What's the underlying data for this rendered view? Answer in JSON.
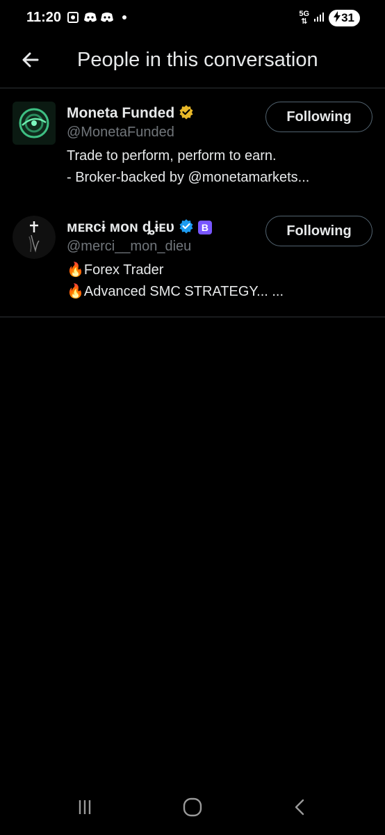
{
  "status_bar": {
    "time": "11:20",
    "network": "5G",
    "battery": "31"
  },
  "header": {
    "title": "People in this conversation"
  },
  "people": [
    {
      "name": "Moneta Funded",
      "handle": "@MonetaFunded",
      "bio_line1": "Trade to perform, perform to earn.",
      "bio_line2": "- Broker-backed by @monetamarkets...",
      "follow_label": "Following",
      "verified_color": "#e8b829"
    },
    {
      "name": "ᴍᴇʀᴄɨ ᴍᴏɴ ȡɨᴇᴜ",
      "handle": "@merci__mon_dieu",
      "bio_line1": "🔥Forex Trader",
      "bio_line2": "🔥Advanced SMC STRATEGY... ...",
      "follow_label": "Following",
      "verified_color": "#1d9bf0",
      "badge": "B"
    }
  ],
  "colors": {
    "background": "#000000",
    "text": "#e7e9ea",
    "secondary_text": "#71767b",
    "divider": "#2f3336"
  }
}
